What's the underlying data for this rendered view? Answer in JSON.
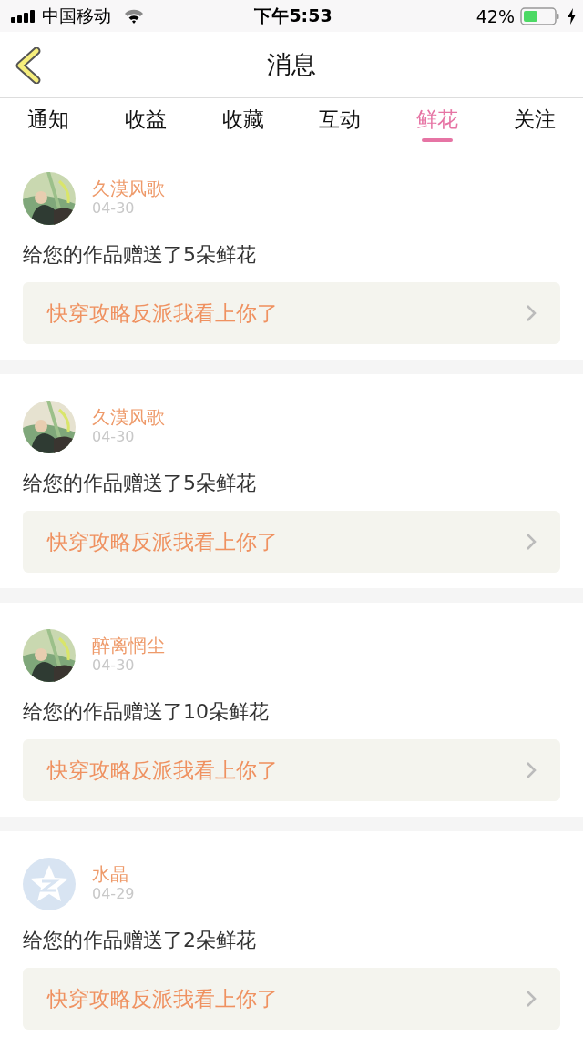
{
  "status_bar": {
    "carrier": "中国移动",
    "time": "下午5:53",
    "battery": "42%"
  },
  "nav": {
    "title": "消息"
  },
  "tabs": [
    {
      "label": "通知",
      "selected": false
    },
    {
      "label": "收益",
      "selected": false
    },
    {
      "label": "收藏",
      "selected": false
    },
    {
      "label": "互动",
      "selected": false
    },
    {
      "label": "鲜花",
      "selected": true
    },
    {
      "label": "关注",
      "selected": false
    }
  ],
  "messages": [
    {
      "name": "久漠风歌",
      "date": "04-30",
      "text": "给您的作品赠送了5朵鲜花",
      "book": "快穿攻略反派我看上你了"
    },
    {
      "name": "久漠风歌",
      "date": "04-30",
      "text": "给您的作品赠送了5朵鲜花",
      "book": "快穿攻略反派我看上你了"
    },
    {
      "name": "醉离惘尘",
      "date": "04-30",
      "text": "给您的作品赠送了10朵鲜花",
      "book": "快穿攻略反派我看上你了"
    },
    {
      "avatar": {
        "kind": "default"
      },
      "name": "水晶",
      "date": "04-29",
      "text": "给您的作品赠送了2朵鲜花",
      "book": "快穿攻略反派我看上你了"
    }
  ]
}
